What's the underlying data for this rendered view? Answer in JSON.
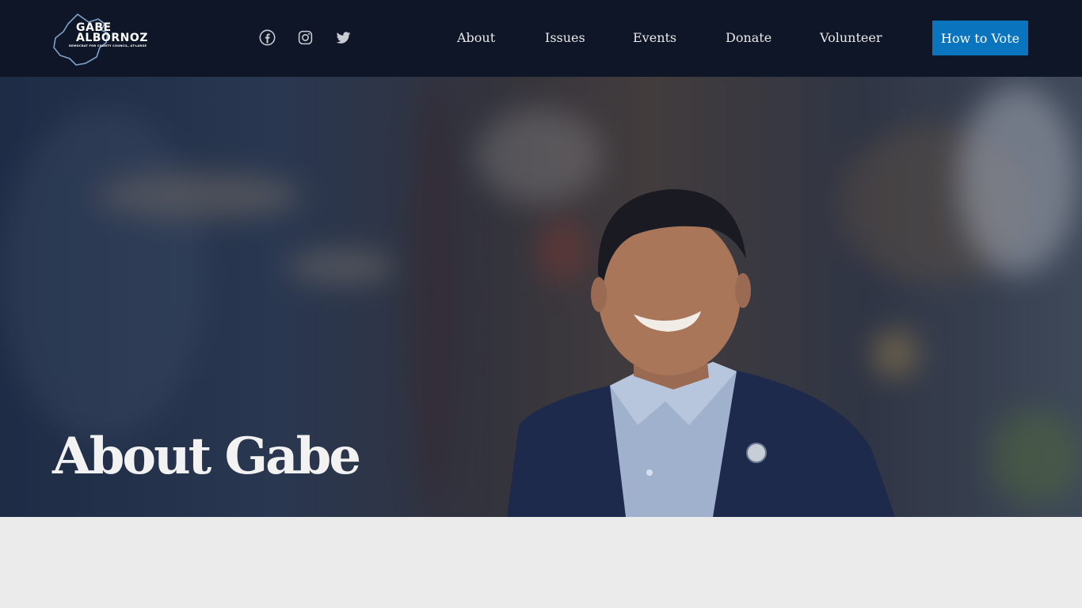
{
  "logo": {
    "line1": "GABE",
    "line2": "ALBORNOZ",
    "tagline": "DEMOCRAT FOR COUNTY COUNCIL, AT-LARGE"
  },
  "social": [
    {
      "name": "facebook-icon"
    },
    {
      "name": "instagram-icon"
    },
    {
      "name": "twitter-icon"
    }
  ],
  "nav": {
    "items": [
      {
        "label": "About"
      },
      {
        "label": "Issues"
      },
      {
        "label": "Events"
      },
      {
        "label": "Donate"
      },
      {
        "label": "Volunteer"
      }
    ],
    "cta_label": "How to Vote"
  },
  "hero": {
    "title": "About Gabe"
  },
  "colors": {
    "header_bg": "#0e1628",
    "cta_bg": "#0a74bf",
    "page_bg": "#ebebeb"
  }
}
